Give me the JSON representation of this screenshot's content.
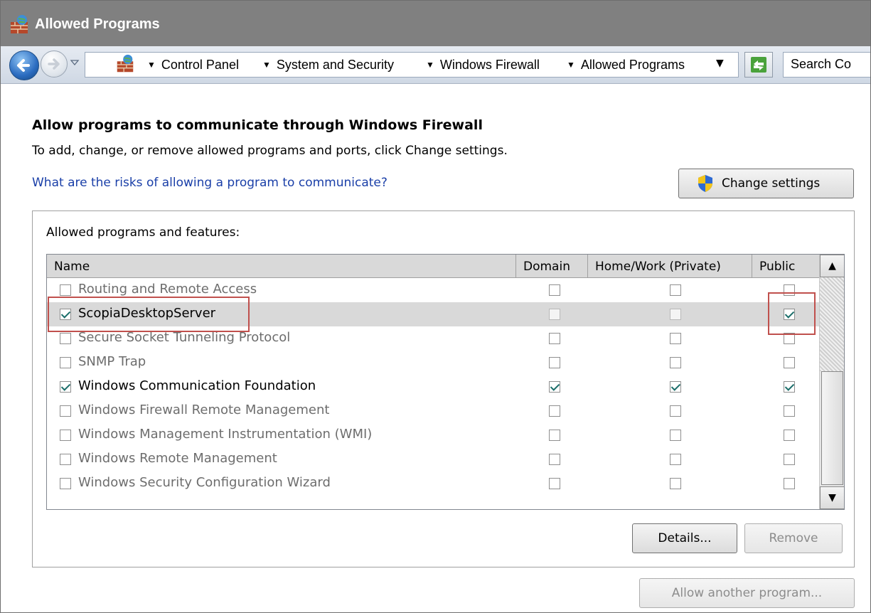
{
  "window": {
    "title": "Allowed Programs"
  },
  "address_bar": {
    "crumbs": [
      "Control Panel",
      "System and Security",
      "Windows Firewall",
      "Allowed Programs"
    ],
    "search_placeholder": "Search Co"
  },
  "content": {
    "heading": "Allow programs to communicate through Windows Firewall",
    "subheading": "To add, change, or remove allowed programs and ports, click Change settings.",
    "risk_link": "What are the risks of allowing a program to communicate?",
    "change_settings_label": "Change settings",
    "group_label": "Allowed programs and features:",
    "columns": [
      "Name",
      "Domain",
      "Home/Work (Private)",
      "Public"
    ],
    "rows": [
      {
        "name": "Routing and Remote Access",
        "enabled": false,
        "domain": false,
        "private": false,
        "public": false,
        "selected": false
      },
      {
        "name": "ScopiaDesktopServer",
        "enabled": true,
        "domain": false,
        "private": false,
        "public": true,
        "selected": true
      },
      {
        "name": "Secure Socket Tunneling Protocol",
        "enabled": false,
        "domain": false,
        "private": false,
        "public": false,
        "selected": false
      },
      {
        "name": "SNMP Trap",
        "enabled": false,
        "domain": false,
        "private": false,
        "public": false,
        "selected": false
      },
      {
        "name": "Windows Communication Foundation",
        "enabled": true,
        "domain": true,
        "private": true,
        "public": true,
        "selected": false
      },
      {
        "name": "Windows Firewall Remote Management",
        "enabled": false,
        "domain": false,
        "private": false,
        "public": false,
        "selected": false
      },
      {
        "name": "Windows Management Instrumentation (WMI)",
        "enabled": false,
        "domain": false,
        "private": false,
        "public": false,
        "selected": false
      },
      {
        "name": "Windows Remote Management",
        "enabled": false,
        "domain": false,
        "private": false,
        "public": false,
        "selected": false
      },
      {
        "name": "Windows Security Configuration Wizard",
        "enabled": false,
        "domain": false,
        "private": false,
        "public": false,
        "selected": false
      }
    ],
    "details_label": "Details...",
    "remove_label": "Remove",
    "allow_another_label": "Allow another program..."
  },
  "colors": {
    "highlight": "#c0504d",
    "link": "#1a3fa8",
    "title_bar": "#808080"
  }
}
